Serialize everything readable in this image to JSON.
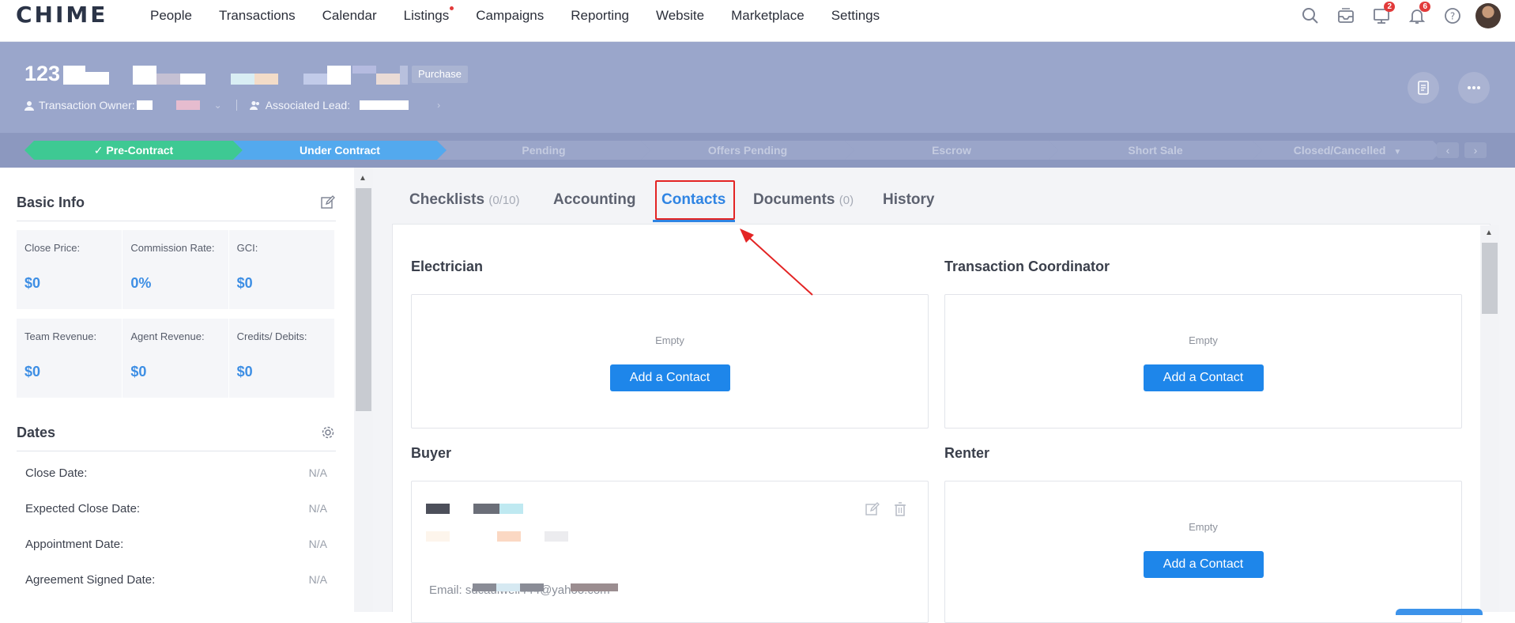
{
  "brand": {
    "logo": "CHIME"
  },
  "nav": {
    "items": [
      {
        "label": "People"
      },
      {
        "label": "Transactions"
      },
      {
        "label": "Calendar"
      },
      {
        "label": "Listings",
        "dot": true
      },
      {
        "label": "Campaigns"
      },
      {
        "label": "Reporting"
      },
      {
        "label": "Website"
      },
      {
        "label": "Marketplace"
      },
      {
        "label": "Settings"
      }
    ],
    "icons": [
      {
        "name": "search-icon"
      },
      {
        "name": "inbox-icon"
      },
      {
        "name": "monitor-icon",
        "badge": "2"
      },
      {
        "name": "bell-icon",
        "badge": "6"
      },
      {
        "name": "help-icon"
      }
    ]
  },
  "header": {
    "title": "123",
    "tag": "Purchase",
    "owner_label": "Transaction Owner:",
    "lead_label": "Associated Lead:"
  },
  "stages": [
    {
      "label": "Pre-Contract",
      "state": "done"
    },
    {
      "label": "Under Contract",
      "state": "current"
    },
    {
      "label": "Pending",
      "state": "todo"
    },
    {
      "label": "Offers Pending",
      "state": "todo"
    },
    {
      "label": "Escrow",
      "state": "todo"
    },
    {
      "label": "Short Sale",
      "state": "todo"
    },
    {
      "label": "Closed/Cancelled",
      "state": "todo"
    }
  ],
  "basic_info": {
    "title": "Basic Info",
    "row1": [
      {
        "label": "Close Price:",
        "value": "$0"
      },
      {
        "label": "Commission Rate:",
        "value": "0%"
      },
      {
        "label": "GCI:",
        "value": "$0"
      }
    ],
    "row2": [
      {
        "label": "Team Revenue:",
        "value": "$0"
      },
      {
        "label": "Agent Revenue:",
        "value": "$0"
      },
      {
        "label": "Credits/ Debits:",
        "value": "$0"
      }
    ]
  },
  "dates": {
    "title": "Dates",
    "rows": [
      {
        "label": "Close Date:",
        "value": "N/A"
      },
      {
        "label": "Expected Close Date:",
        "value": "N/A"
      },
      {
        "label": "Appointment Date:",
        "value": "N/A"
      },
      {
        "label": "Agreement Signed Date:",
        "value": "N/A"
      }
    ]
  },
  "tabs": [
    {
      "label": "Checklists",
      "count": "(0/10)"
    },
    {
      "label": "Accounting",
      "count": ""
    },
    {
      "label": "Contacts",
      "count": "",
      "active": true
    },
    {
      "label": "Documents",
      "count": "(0)"
    },
    {
      "label": "History",
      "count": ""
    }
  ],
  "contacts": {
    "empty_text": "Empty",
    "add_label": "Add a Contact",
    "sections": [
      {
        "title": "Electrician"
      },
      {
        "title": "Transaction Coordinator"
      },
      {
        "title": "Buyer"
      },
      {
        "title": "Renter"
      }
    ],
    "buyer_email": "Email: sdcaulwell444@yahoo.com"
  },
  "colors": {
    "accent": "#2f84e3",
    "done_stage": "#3ec993",
    "current_stage": "#53a9ee",
    "annotation": "#e32424"
  }
}
